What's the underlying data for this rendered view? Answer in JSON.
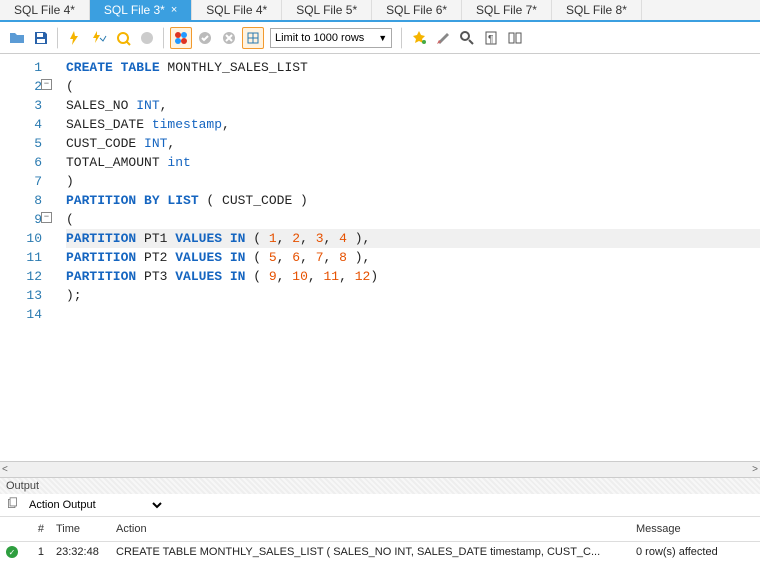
{
  "tabs": [
    {
      "label": "SQL File 4*",
      "active": false
    },
    {
      "label": "SQL File 3*",
      "active": true
    },
    {
      "label": "SQL File 4*",
      "active": false
    },
    {
      "label": "SQL File 5*",
      "active": false
    },
    {
      "label": "SQL File 6*",
      "active": false
    },
    {
      "label": "SQL File 7*",
      "active": false
    },
    {
      "label": "SQL File 8*",
      "active": false
    }
  ],
  "toolbar": {
    "limit_label": "Limit to 1000 rows"
  },
  "code": {
    "lines": [
      {
        "n": 1,
        "tokens": [
          [
            "kw",
            "CREATE TABLE"
          ],
          [
            "id",
            " MONTHLY_SALES_LIST"
          ]
        ]
      },
      {
        "n": 2,
        "fold": true,
        "tokens": [
          [
            "id",
            "("
          ]
        ]
      },
      {
        "n": 3,
        "tokens": [
          [
            "id",
            "SALES_NO "
          ],
          [
            "ty",
            "INT"
          ],
          [
            "id",
            ","
          ]
        ]
      },
      {
        "n": 4,
        "tokens": [
          [
            "id",
            "SALES_DATE "
          ],
          [
            "ty",
            "timestamp"
          ],
          [
            "id",
            ","
          ]
        ]
      },
      {
        "n": 5,
        "tokens": [
          [
            "id",
            "CUST_CODE "
          ],
          [
            "ty",
            "INT"
          ],
          [
            "id",
            ","
          ]
        ]
      },
      {
        "n": 6,
        "tokens": [
          [
            "id",
            "TOTAL_AMOUNT "
          ],
          [
            "ty",
            "int"
          ]
        ]
      },
      {
        "n": 7,
        "tokens": [
          [
            "id",
            ")"
          ]
        ]
      },
      {
        "n": 8,
        "tokens": [
          [
            "kw",
            "PARTITION BY LIST"
          ],
          [
            "id",
            " ( CUST_CODE )"
          ]
        ]
      },
      {
        "n": 9,
        "fold": true,
        "tokens": [
          [
            "id",
            "("
          ]
        ]
      },
      {
        "n": 10,
        "hl": true,
        "tokens": [
          [
            "kw",
            "PARTITION"
          ],
          [
            "id",
            " PT1 "
          ],
          [
            "kw",
            "VALUES IN"
          ],
          [
            "id",
            " ( "
          ],
          [
            "num",
            "1"
          ],
          [
            "id",
            ", "
          ],
          [
            "num",
            "2"
          ],
          [
            "id",
            ", "
          ],
          [
            "num",
            "3"
          ],
          [
            "id",
            ", "
          ],
          [
            "num",
            "4"
          ],
          [
            "id",
            " ),"
          ]
        ]
      },
      {
        "n": 11,
        "tokens": [
          [
            "kw",
            "PARTITION"
          ],
          [
            "id",
            " PT2 "
          ],
          [
            "kw",
            "VALUES IN"
          ],
          [
            "id",
            " ( "
          ],
          [
            "num",
            "5"
          ],
          [
            "id",
            ", "
          ],
          [
            "num",
            "6"
          ],
          [
            "id",
            ", "
          ],
          [
            "num",
            "7"
          ],
          [
            "id",
            ", "
          ],
          [
            "num",
            "8"
          ],
          [
            "id",
            " ),"
          ]
        ]
      },
      {
        "n": 12,
        "tokens": [
          [
            "kw",
            "PARTITION"
          ],
          [
            "id",
            " PT3 "
          ],
          [
            "kw",
            "VALUES IN"
          ],
          [
            "id",
            " ( "
          ],
          [
            "num",
            "9"
          ],
          [
            "id",
            ", "
          ],
          [
            "num",
            "10"
          ],
          [
            "id",
            ", "
          ],
          [
            "num",
            "11"
          ],
          [
            "id",
            ", "
          ],
          [
            "num",
            "12"
          ],
          [
            "id",
            ")"
          ]
        ]
      },
      {
        "n": 13,
        "tokens": [
          [
            "id",
            ");"
          ]
        ]
      },
      {
        "n": 14,
        "tokens": []
      }
    ]
  },
  "output": {
    "header": "Output",
    "selector": "Action Output",
    "columns": {
      "num": "#",
      "time": "Time",
      "action": "Action",
      "message": "Message"
    },
    "rows": [
      {
        "status": "ok",
        "num": "1",
        "time": "23:32:48",
        "action": "CREATE TABLE MONTHLY_SALES_LIST ( SALES_NO INT, SALES_DATE timestamp, CUST_C...",
        "message": "0 row(s) affected"
      }
    ]
  }
}
